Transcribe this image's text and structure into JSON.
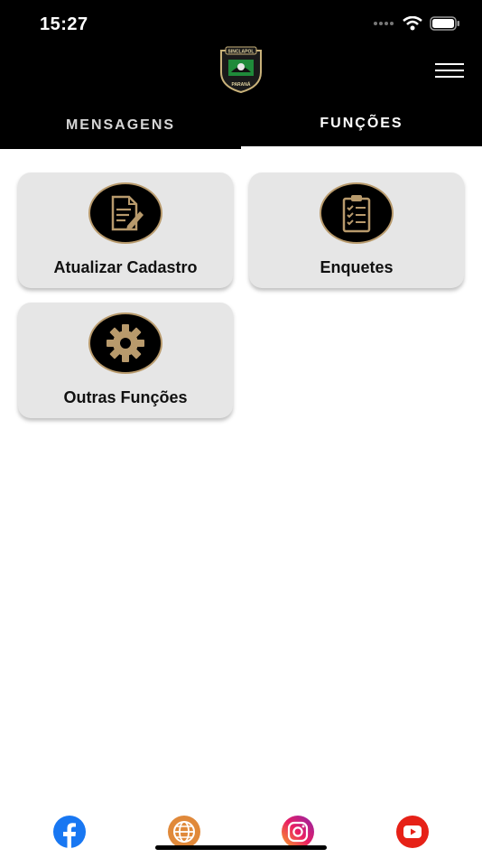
{
  "status_bar": {
    "time": "15:27"
  },
  "logo": {
    "top_text": "SINCLAPOL",
    "bottom_text": "PARANÁ"
  },
  "tabs": [
    {
      "label": "MENSAGENS",
      "active": false
    },
    {
      "label": "FUNÇÕES",
      "active": true
    }
  ],
  "cards": [
    {
      "label": "Atualizar Cadastro",
      "icon": "document-edit-icon"
    },
    {
      "label": "Enquetes",
      "icon": "clipboard-list-icon"
    },
    {
      "label": "Outras Funções",
      "icon": "gear-icon"
    }
  ],
  "social": [
    {
      "name": "facebook-icon",
      "color": "#1877F2"
    },
    {
      "name": "website-globe-icon",
      "color": "#E0893A"
    },
    {
      "name": "instagram-icon",
      "color": "#C13584"
    },
    {
      "name": "youtube-icon",
      "color": "#E62117"
    }
  ],
  "colors": {
    "header_bg": "#000000",
    "card_bg": "#e6e6e6",
    "icon_gold": "#b89a6c"
  }
}
